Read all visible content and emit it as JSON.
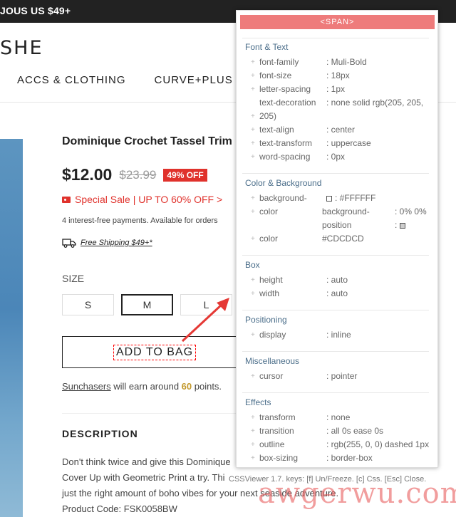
{
  "topbar": {
    "promo_text": "JOUS US $49+"
  },
  "logo": {
    "text": "SHE"
  },
  "nav": {
    "items": [
      "ACCS & CLOTHING",
      "CURVE+PLUS"
    ]
  },
  "product": {
    "title": "Dominique Crochet Tassel Trim",
    "price_current": "$12.00",
    "price_original": "$23.99",
    "discount_badge": "49% OFF",
    "sale_text": "Special Sale | UP TO 60% OFF >",
    "installments_text": "4 interest-free payments. Available for orders",
    "shipping_text": "Free Shipping $49+*",
    "size_label": "SIZE",
    "sizes": [
      "S",
      "M",
      "L"
    ],
    "selected_size": "M",
    "add_to_bag_label": "ADD TO BAG",
    "points": {
      "link": "Sunchasers",
      "before": " will earn around ",
      "value": "60",
      "after": " points."
    },
    "description_heading": "DESCRIPTION",
    "description_lines": [
      "Don't think twice and give this Dominique",
      "Cover Up with Geometric Print a try. Thi",
      "just the right amount of boho vibes for your next seaside adventure.",
      "Product Code: FSK0058BW"
    ]
  },
  "cssviewer": {
    "header": "<SPAN>",
    "font": {
      "title": "Font & Text",
      "rows": [
        {
          "prop": "font-family",
          "val": ": Muli-Bold"
        },
        {
          "prop": "font-size",
          "val": ": 18px"
        },
        {
          "prop": "letter-spacing",
          "val": ": 1px"
        },
        {
          "prop": "text-decoration",
          "val": ": none solid rgb(205, 205,"
        },
        {
          "prop": "205)",
          "val": ""
        },
        {
          "prop": "text-align",
          "val": ": center"
        },
        {
          "prop": "text-transform",
          "val": ": uppercase"
        },
        {
          "prop": "word-spacing",
          "val": ": 0px"
        }
      ]
    },
    "color": {
      "title": "Color & Background",
      "rows": [
        {
          "prop": "background-",
          "val": ": #FFFFFF"
        },
        {
          "prop": "color",
          "val": "background-",
          "val2": ": 0% 0%"
        },
        {
          "prop": "",
          "val": "position",
          "val2": ":"
        },
        {
          "prop": "color",
          "val": "#CDCDCD"
        }
      ]
    },
    "box": {
      "title": "Box",
      "rows": [
        {
          "prop": "height",
          "val": ": auto"
        },
        {
          "prop": "width",
          "val": ": auto"
        }
      ]
    },
    "positioning": {
      "title": "Positioning",
      "rows": [
        {
          "prop": "display",
          "val": ": inline"
        }
      ]
    },
    "misc": {
      "title": "Miscellaneous",
      "rows": [
        {
          "prop": "cursor",
          "val": ": pointer"
        }
      ]
    },
    "effects": {
      "title": "Effects",
      "rows": [
        {
          "prop": "transform",
          "val": ": none"
        },
        {
          "prop": "transition",
          "val": ": all 0s ease 0s"
        },
        {
          "prop": "outline",
          "val": ": rgb(255, 0, 0) dashed 1px"
        },
        {
          "prop": "box-sizing",
          "val": ": border-box"
        }
      ]
    },
    "footer": "CSSViewer 1.7. keys: [f] Un/Freeze. [c] Css. [Esc] Close."
  },
  "watermark": "awgerwu.com",
  "colors": {
    "accent_red": "#e0322c",
    "points_gold": "#c39a2e",
    "cssviewer_header": "#ee7b7b",
    "section_title": "#4b6e8a"
  }
}
